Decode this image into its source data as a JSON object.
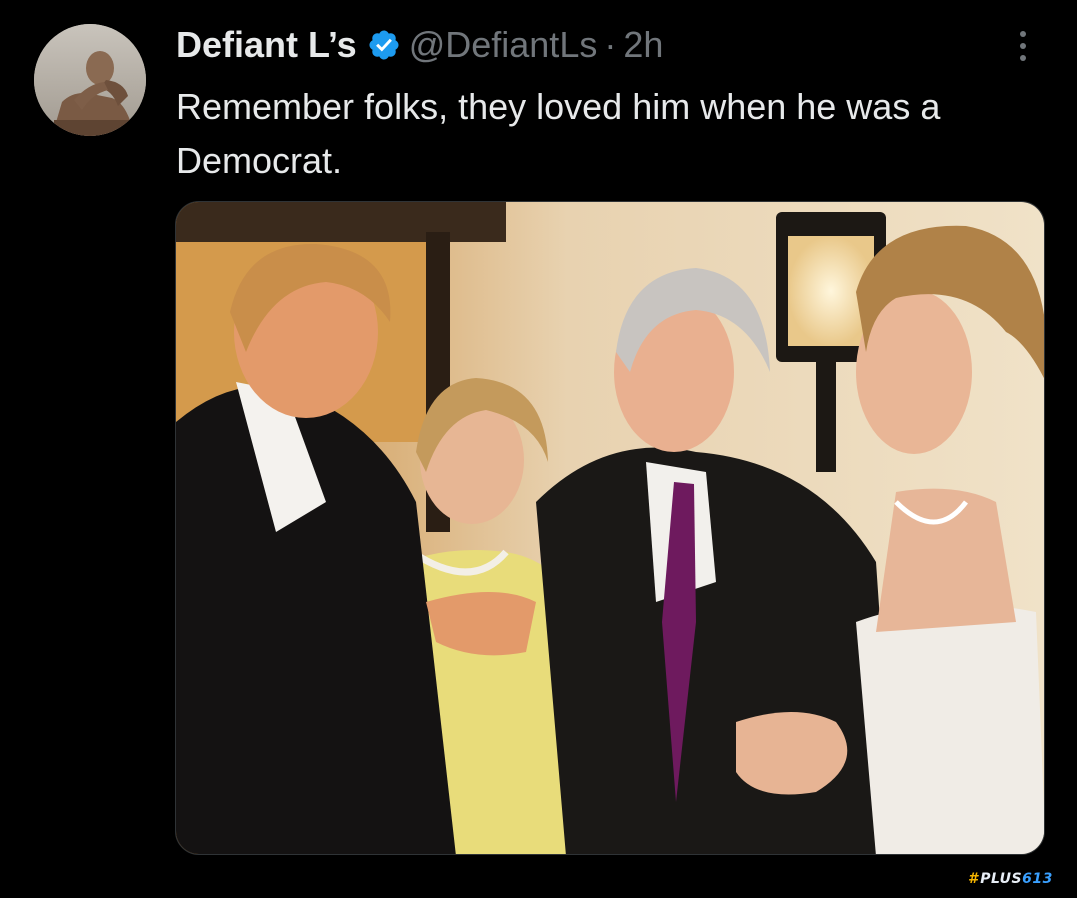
{
  "tweet": {
    "author": {
      "display_name": "Defiant L’s",
      "handle": "@DefiantLs",
      "verified": true,
      "avatar_icon": "avatar-thinking-statue"
    },
    "separator": "·",
    "timestamp": "2h",
    "text": "Remember folks, they loved him when he was a Democrat.",
    "more_icon": "more-vertical-icon",
    "media": {
      "type": "photo",
      "subject": "four people at a formal event"
    }
  },
  "watermark": {
    "hash": "#",
    "text": "PLUS",
    "number": "613"
  },
  "colors": {
    "background": "#000000",
    "text_primary": "#e7e9ea",
    "text_secondary": "#71767b",
    "verified_blue": "#1d9bf0"
  }
}
